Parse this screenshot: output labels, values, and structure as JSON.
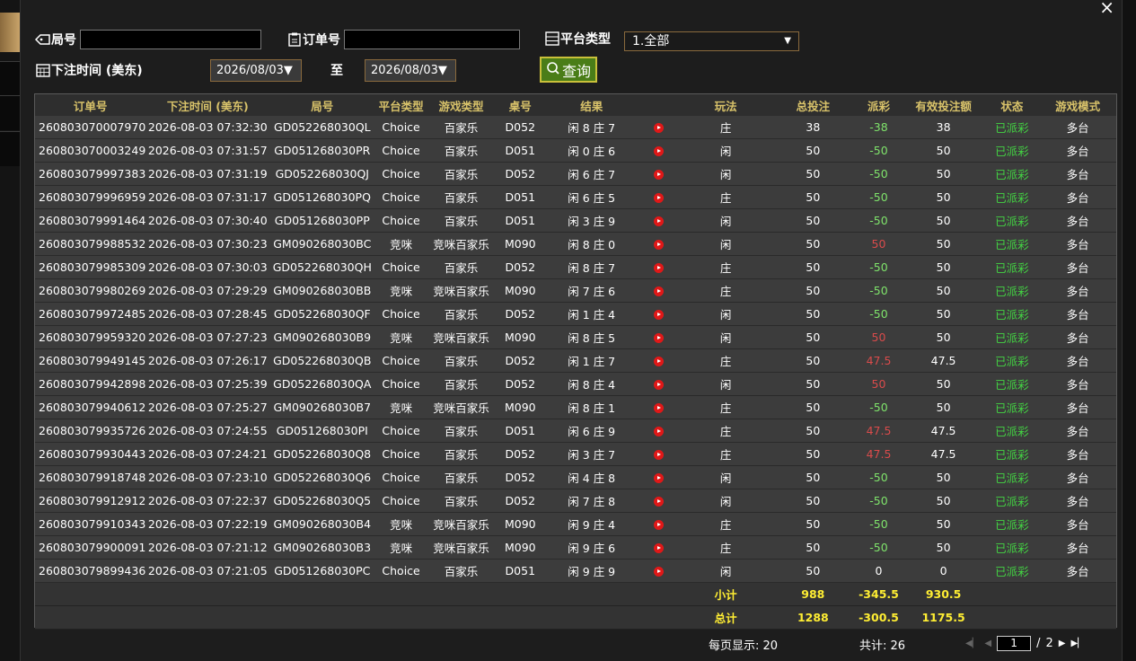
{
  "filters": {
    "round_label": "局号",
    "order_label": "订单号",
    "platform_label": "平台类型",
    "platform_value": "1.全部",
    "time_label": "下注时间 (美东)",
    "date_from": "2026/08/03▼",
    "to_label": "至",
    "date_to": "2026/08/03▼",
    "query_label": "查询"
  },
  "close_label": "×",
  "table": {
    "headers": [
      "订单号",
      "下注时间 (美东)",
      "局号",
      "平台类型",
      "游戏类型",
      "桌号",
      "结果",
      "",
      "玩法",
      "总投注",
      "派彩",
      "有效投注额",
      "状态",
      "游戏模式"
    ],
    "rows": [
      [
        "260803070007970",
        "2026-08-03 07:32:30",
        "GD052268030QL",
        "Choice",
        "百家乐",
        "D052",
        "闲 8 庄 7",
        "庄",
        "38",
        "-38",
        "38",
        "已派彩",
        "多台"
      ],
      [
        "260803070003249",
        "2026-08-03 07:31:57",
        "GD051268030PR",
        "Choice",
        "百家乐",
        "D051",
        "闲 0 庄 6",
        "闲",
        "50",
        "-50",
        "50",
        "已派彩",
        "多台"
      ],
      [
        "260803079997383",
        "2026-08-03 07:31:19",
        "GD052268030QJ",
        "Choice",
        "百家乐",
        "D052",
        "闲 6 庄 7",
        "闲",
        "50",
        "-50",
        "50",
        "已派彩",
        "多台"
      ],
      [
        "260803079996959",
        "2026-08-03 07:31:17",
        "GD051268030PQ",
        "Choice",
        "百家乐",
        "D051",
        "闲 6 庄 5",
        "庄",
        "50",
        "-50",
        "50",
        "已派彩",
        "多台"
      ],
      [
        "260803079991464",
        "2026-08-03 07:30:40",
        "GD051268030PP",
        "Choice",
        "百家乐",
        "D051",
        "闲 3 庄 9",
        "闲",
        "50",
        "-50",
        "50",
        "已派彩",
        "多台"
      ],
      [
        "260803079988532",
        "2026-08-03 07:30:23",
        "GM090268030BC",
        "竞咪",
        "竞咪百家乐",
        "M090",
        "闲 8 庄 0",
        "闲",
        "50",
        "50",
        "50",
        "已派彩",
        "多台"
      ],
      [
        "260803079985309",
        "2026-08-03 07:30:03",
        "GD052268030QH",
        "Choice",
        "百家乐",
        "D052",
        "闲 8 庄 7",
        "庄",
        "50",
        "-50",
        "50",
        "已派彩",
        "多台"
      ],
      [
        "260803079980269",
        "2026-08-03 07:29:29",
        "GM090268030BB",
        "竞咪",
        "竞咪百家乐",
        "M090",
        "闲 7 庄 6",
        "庄",
        "50",
        "-50",
        "50",
        "已派彩",
        "多台"
      ],
      [
        "260803079972485",
        "2026-08-03 07:28:45",
        "GD052268030QF",
        "Choice",
        "百家乐",
        "D052",
        "闲 1 庄 4",
        "闲",
        "50",
        "-50",
        "50",
        "已派彩",
        "多台"
      ],
      [
        "260803079959320",
        "2026-08-03 07:27:23",
        "GM090268030B9",
        "竞咪",
        "竞咪百家乐",
        "M090",
        "闲 8 庄 5",
        "闲",
        "50",
        "50",
        "50",
        "已派彩",
        "多台"
      ],
      [
        "260803079949145",
        "2026-08-03 07:26:17",
        "GD052268030QB",
        "Choice",
        "百家乐",
        "D052",
        "闲 1 庄 7",
        "庄",
        "50",
        "47.5",
        "47.5",
        "已派彩",
        "多台"
      ],
      [
        "260803079942898",
        "2026-08-03 07:25:39",
        "GD052268030QA",
        "Choice",
        "百家乐",
        "D052",
        "闲 8 庄 4",
        "闲",
        "50",
        "50",
        "50",
        "已派彩",
        "多台"
      ],
      [
        "260803079940612",
        "2026-08-03 07:25:27",
        "GM090268030B7",
        "竞咪",
        "竞咪百家乐",
        "M090",
        "闲 8 庄 1",
        "庄",
        "50",
        "-50",
        "50",
        "已派彩",
        "多台"
      ],
      [
        "260803079935726",
        "2026-08-03 07:24:55",
        "GD051268030PI",
        "Choice",
        "百家乐",
        "D051",
        "闲 6 庄 9",
        "庄",
        "50",
        "47.5",
        "47.5",
        "已派彩",
        "多台"
      ],
      [
        "260803079930443",
        "2026-08-03 07:24:21",
        "GD052268030Q8",
        "Choice",
        "百家乐",
        "D052",
        "闲 3 庄 7",
        "庄",
        "50",
        "47.5",
        "47.5",
        "已派彩",
        "多台"
      ],
      [
        "260803079918748",
        "2026-08-03 07:23:10",
        "GD052268030Q6",
        "Choice",
        "百家乐",
        "D052",
        "闲 4 庄 8",
        "闲",
        "50",
        "-50",
        "50",
        "已派彩",
        "多台"
      ],
      [
        "260803079912912",
        "2026-08-03 07:22:37",
        "GD052268030Q5",
        "Choice",
        "百家乐",
        "D052",
        "闲 7 庄 8",
        "闲",
        "50",
        "-50",
        "50",
        "已派彩",
        "多台"
      ],
      [
        "260803079910343",
        "2026-08-03 07:22:19",
        "GM090268030B4",
        "竞咪",
        "竞咪百家乐",
        "M090",
        "闲 9 庄 4",
        "庄",
        "50",
        "-50",
        "50",
        "已派彩",
        "多台"
      ],
      [
        "260803079900091",
        "2026-08-03 07:21:12",
        "GM090268030B3",
        "竞咪",
        "竞咪百家乐",
        "M090",
        "闲 9 庄 6",
        "庄",
        "50",
        "-50",
        "50",
        "已派彩",
        "多台"
      ],
      [
        "260803079899436",
        "2026-08-03 07:21:05",
        "GD051268030PC",
        "Choice",
        "百家乐",
        "D051",
        "闲 9 庄 9",
        "闲",
        "50",
        "0",
        "0",
        "已派彩",
        "多台"
      ]
    ],
    "subtotal": {
      "label": "小计",
      "total_bet": "988",
      "payout": "-345.5",
      "valid_bet": "930.5"
    },
    "total": {
      "label": "总计",
      "total_bet": "1288",
      "payout": "-300.5",
      "valid_bet": "1175.5"
    }
  },
  "footer": {
    "per_page": "每页显示: 20",
    "count": "共计: 26",
    "page_current": "1",
    "page_sep": "/",
    "page_total": "2"
  },
  "colors": {
    "paid": "#43d443",
    "win": "#7fe36b",
    "loss": "#d94b4b",
    "sum": "#ffee33",
    "header": "#d9c36a"
  }
}
